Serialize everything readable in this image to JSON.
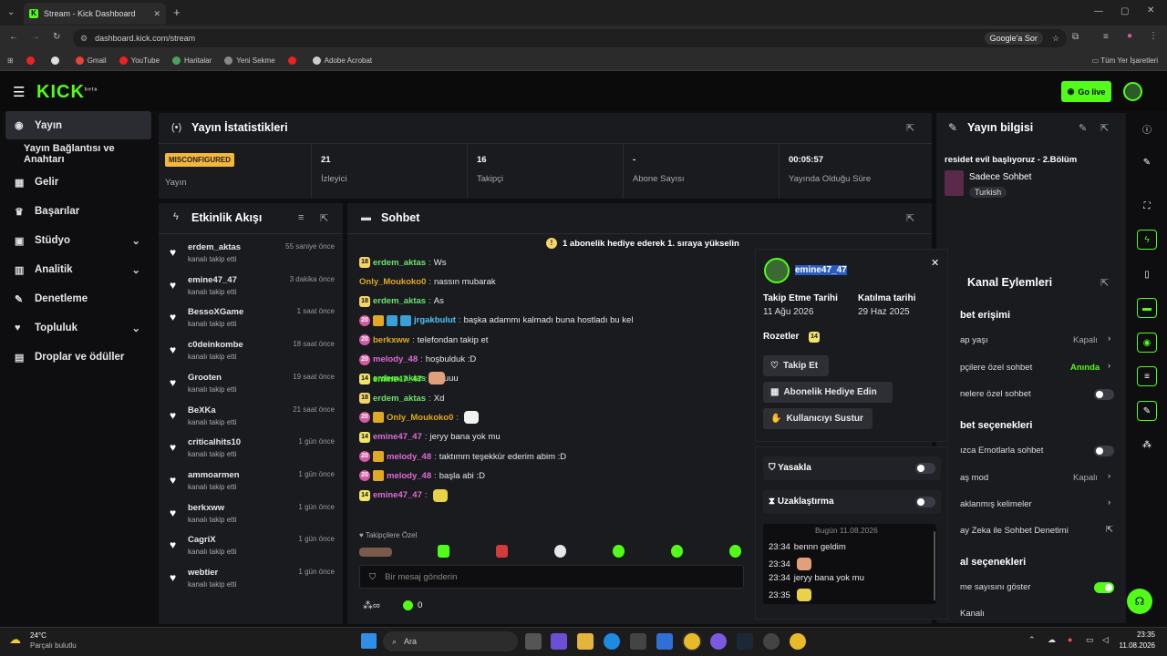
{
  "browser": {
    "tab_title": "Stream - Kick Dashboard",
    "url": "dashboard.kick.com/stream",
    "ask_google": "Google'a Sor",
    "bookmarks": [
      {
        "label": "",
        "color": "#e22"
      },
      {
        "label": "",
        "color": "#ddd"
      },
      {
        "label": "Gmail",
        "color": "#ea4335"
      },
      {
        "label": "YouTube",
        "color": "#e22"
      },
      {
        "label": "Haritalar",
        "color": "#4aa35b"
      },
      {
        "label": "Yeni Sekme",
        "color": "#888"
      },
      {
        "label": "",
        "color": "#e22"
      },
      {
        "label": "Adobe Acrobat",
        "color": "#ccc"
      }
    ],
    "all_bookmarks": "Tüm Yer İşaretleri"
  },
  "header": {
    "logo": "KICK",
    "logo_sup": "beta",
    "go_live": "Go live"
  },
  "sidebar": {
    "items": [
      {
        "label": "Yayın",
        "icon": "broadcast-icon"
      },
      {
        "label": "Yayın Bağlantısı ve Anahtarı",
        "icon": ""
      },
      {
        "label": "Gelir",
        "icon": "chart-icon"
      },
      {
        "label": "Başarılar",
        "icon": "trophy-icon"
      },
      {
        "label": "Stüdyo",
        "icon": "studio-icon"
      },
      {
        "label": "Analitik",
        "icon": "analytics-icon"
      },
      {
        "label": "Denetleme",
        "icon": "wrench-icon"
      },
      {
        "label": "Topluluk",
        "icon": "community-icon"
      },
      {
        "label": "Droplar ve ödüller",
        "icon": "gift-icon"
      }
    ]
  },
  "stats": {
    "title": "Yayın İstatistikleri",
    "items": [
      {
        "value": "MISCONFIGURED",
        "label": "Yayın"
      },
      {
        "value": "21",
        "label": "İzleyici"
      },
      {
        "value": "16",
        "label": "Takipçi"
      },
      {
        "value": "-",
        "label": "Abone Sayısı"
      },
      {
        "value": "00:05:57",
        "label": "Yayında Olduğu Süre"
      }
    ]
  },
  "stream_info": {
    "title": "Yayın bilgisi",
    "stream_title": "residet evil başlıyoruz - 2.Bölüm",
    "category": "Sadece Sohbet",
    "tag": "Turkish"
  },
  "activity": {
    "title": "Etkinlik Akışı",
    "items": [
      {
        "name": "erdem_aktas",
        "time": "55 saniye önce",
        "sub": "kanalı takip etti"
      },
      {
        "name": "emine47_47",
        "time": "3 dakika önce",
        "sub": "kanalı takip etti"
      },
      {
        "name": "BessoXGame",
        "time": "1 saat önce",
        "sub": "kanalı takip etti"
      },
      {
        "name": "c0deinkombe",
        "time": "18 saat önce",
        "sub": "kanalı takip etti"
      },
      {
        "name": "Grooten",
        "time": "19 saat önce",
        "sub": "kanalı takip etti"
      },
      {
        "name": "BeXKa",
        "time": "21 saat önce",
        "sub": "kanalı takip etti"
      },
      {
        "name": "criticalhits10",
        "time": "1 gün önce",
        "sub": "kanalı takip etti"
      },
      {
        "name": "ammoarmen",
        "time": "1 gün önce",
        "sub": "kanalı takip etti"
      },
      {
        "name": "berkxww",
        "time": "1 gün önce",
        "sub": "kanalı takip etti"
      },
      {
        "name": "CagriX",
        "time": "1 gün önce",
        "sub": "kanalı takip etti"
      },
      {
        "name": "webtier",
        "time": "1 gün önce",
        "sub": "kanalı takip etti"
      }
    ]
  },
  "chat": {
    "title": "Sohbet",
    "pinned": "1 abonelik hediye ederek 1. sıraya yükselin",
    "messages": [
      {
        "badge": "18",
        "user": "erdem_aktas",
        "color": "#6be36b",
        "text": "Ws"
      },
      {
        "badge": "",
        "user": "Only_Moukoko0",
        "color": "#e0a825",
        "text": "nassın mubarak"
      },
      {
        "badge": "18",
        "user": "erdem_aktas",
        "color": "#6be36b",
        "text": "As"
      },
      {
        "badge": "20",
        "user": "jrgakbulut",
        "color": "#4fc3f7",
        "text": "başka adammı kalmadı buna hostladı bu kel"
      },
      {
        "badge": "20",
        "user": "berkxww",
        "color": "#e0a825",
        "text": "telefondan takip et"
      },
      {
        "badge": "20",
        "user": "melody_48",
        "color": "#e06bd6",
        "text": "hoşbulduk :D"
      },
      {
        "badge": "18",
        "user": "erdem_aktas",
        "color": "#6be36b",
        "text": "Yuuuu"
      },
      {
        "badge": "18",
        "user": "erdem_aktas",
        "color": "#6be36b",
        "text": "Xd"
      },
      {
        "badge": "20",
        "user": "Only_Moukoko0",
        "color": "#e0a825",
        "text": ""
      },
      {
        "badge": "14",
        "user": "emine47_47",
        "color": "#e06bd6",
        "text": "jeryy bana yok mu"
      },
      {
        "badge": "20",
        "user": "melody_48",
        "color": "#e06bd6",
        "text": "taktımm teşekkür ederim abim :D"
      },
      {
        "badge": "20",
        "user": "melody_48",
        "color": "#e06bd6",
        "text": "başla abi :D"
      },
      {
        "badge": "14",
        "user": "emine47_47",
        "color": "#e06bd6",
        "text": ""
      }
    ],
    "followers_only": "Takipçilere Özel",
    "input_placeholder": "Bir mesaj gönderin",
    "points": "0"
  },
  "user_card": {
    "username": "emine47_47",
    "follow_date_label": "Takip Etme Tarihi",
    "follow_date": "11 Ağu 2026",
    "join_date_label": "Katılma tarihi",
    "join_date": "29 Haz 2025",
    "badges_label": "Rozetler",
    "badge": "14",
    "follow_btn": "Takip Et",
    "gift_btn": "Abonelik Hediye Edin",
    "mute_btn": "Kullanıcıyı Sustur",
    "ban_label": "Yasakla",
    "timeout_label": "Uzaklaştırma",
    "history_date": "Bugün 11.08.2026",
    "history": [
      {
        "time": "23:34",
        "text": "bennn geldim"
      },
      {
        "time": "23:34",
        "text": ""
      },
      {
        "time": "23:34",
        "text": "jeryy bana yok mu"
      },
      {
        "time": "23:35",
        "text": ""
      }
    ]
  },
  "channel_actions": {
    "title": "Kanal Eylemleri",
    "sections": [
      {
        "title": "bet erişimi"
      },
      {
        "title": "bet seçenekleri"
      },
      {
        "title": "al seçenekleri"
      }
    ],
    "rows": [
      {
        "label": "ap yaşı",
        "value": "Kapalı"
      },
      {
        "label": "pçilere özel sohbet",
        "value": "Anında"
      },
      {
        "label": "nelere özel sohbet",
        "value": ""
      },
      {
        "label": "ızca Emotlarla sohbet",
        "value": ""
      },
      {
        "label": "aş mod",
        "value": "Kapalı"
      },
      {
        "label": "aklanmış kelimeler",
        "value": ""
      },
      {
        "label": "ay Zeka ile Sohbet Denetimi",
        "value": ""
      },
      {
        "label": "me sayısını göster",
        "value": ""
      },
      {
        "label": "Kanalı",
        "value": ""
      }
    ]
  },
  "taskbar": {
    "weather_temp": "24°C",
    "weather_desc": "Parçalı bulutlu",
    "search": "Ara",
    "time": "23:35",
    "date": "11.08.2026"
  },
  "colors": {
    "accent": "#53fc18",
    "panel": "#191b1f",
    "bg": "#0e0e10"
  }
}
